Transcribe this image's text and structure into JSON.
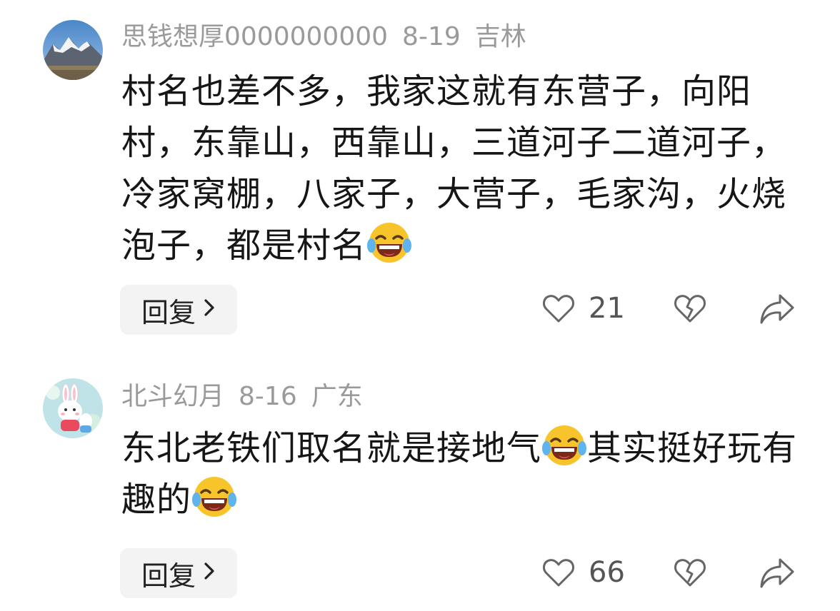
{
  "comments": [
    {
      "username": "思钱想厚0000000000",
      "date": "8-19",
      "location": "吉林",
      "text_parts": [
        "村名也差不多，我家这就有东营子，向阳村，东靠山，西靠山，三道河子二道河子，冷家窝棚，八家子，大营子，毛家沟，火烧泡子，都是村名"
      ],
      "reply_label": "回复",
      "likes": "21",
      "avatar_icon": "mountain-landscape-avatar",
      "emoji_icon": "laughing-tears-emoji"
    },
    {
      "username": "北斗幻月",
      "date": "8-16",
      "location": "广东",
      "text_parts": [
        "东北老铁们取名就是接地气",
        "其实挺好玩有趣的"
      ],
      "reply_label": "回复",
      "likes": "66",
      "avatar_icon": "bunny-cartoon-avatar",
      "emoji_icon": "laughing-tears-emoji"
    }
  ],
  "colors": {
    "meta_gray": "#9a9a9a",
    "text": "#161616",
    "button_bg": "#f3f3f3",
    "icon_stroke": "#666666",
    "emoji_yellow": "#f7c52b"
  }
}
